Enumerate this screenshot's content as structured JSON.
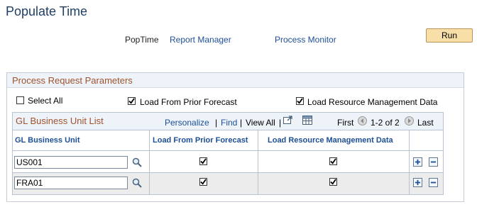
{
  "page": {
    "title": "Populate Time"
  },
  "run_control": {
    "name": "PopTime",
    "report_manager": "Report Manager",
    "process_monitor": "Process Monitor",
    "run_label": "Run"
  },
  "section": {
    "title": "Process Request Parameters",
    "select_all": {
      "label": "Select All",
      "checked": false
    },
    "load_prior_forecast": {
      "label": "Load From Prior Forecast",
      "checked": true
    },
    "load_resource_mgmt": {
      "label": "Load Resource Management Data",
      "checked": true
    }
  },
  "grid": {
    "title": "GL Business Unit List",
    "personalize": "Personalize",
    "sep1": "|",
    "find": "Find",
    "sep2": "|",
    "view_all": "View All",
    "sep3": "|",
    "first": "First",
    "range": "1-2 of 2",
    "last": "Last",
    "headers": [
      "GL Business Unit",
      "Load From Prior Forecast",
      "Load Resource Management Data"
    ],
    "rows": [
      {
        "business_unit": "US001",
        "prior_forecast": true,
        "resource_mgmt": true
      },
      {
        "business_unit": "FRA01",
        "prior_forecast": true,
        "resource_mgmt": true
      }
    ]
  },
  "colors": {
    "link": "#1d4f97",
    "section_title": "#a0522d",
    "run_button": "#f8dfa7",
    "header_bg": "#edf3f9"
  }
}
